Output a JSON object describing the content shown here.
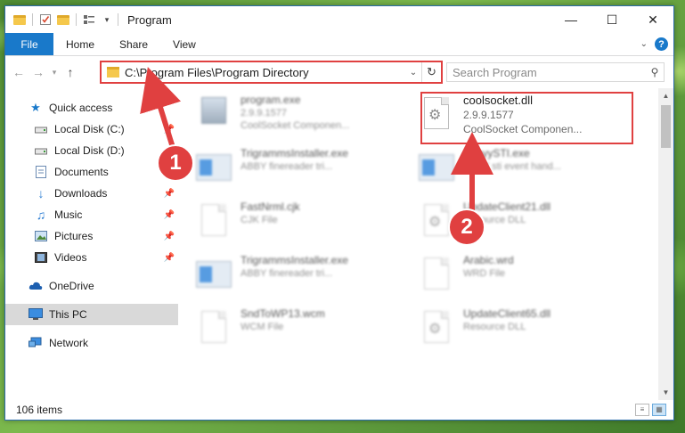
{
  "window": {
    "title": "Program",
    "controls": {
      "minimize": "—",
      "maximize": "☐",
      "close": "✕"
    }
  },
  "ribbon": {
    "tabs": [
      "File",
      "Home",
      "Share",
      "View"
    ],
    "expand_icon": "chevron-down-icon",
    "help_label": "?"
  },
  "address": {
    "path": "C:\\Program Files\\Program Directory",
    "search_placeholder": "Search Program"
  },
  "sidebar": {
    "items": [
      {
        "label": "Quick access",
        "icon": "star-icon",
        "pinned": false
      },
      {
        "label": "Local Disk (C:)",
        "icon": "drive-icon",
        "pinned": true
      },
      {
        "label": "Local Disk (D:)",
        "icon": "drive-icon",
        "pinned": false
      },
      {
        "label": "Documents",
        "icon": "documents-icon",
        "pinned": true
      },
      {
        "label": "Downloads",
        "icon": "download-icon",
        "pinned": true
      },
      {
        "label": "Music",
        "icon": "music-icon",
        "pinned": true
      },
      {
        "label": "Pictures",
        "icon": "pictures-icon",
        "pinned": true
      },
      {
        "label": "Videos",
        "icon": "videos-icon",
        "pinned": true
      },
      {
        "label": "OneDrive",
        "icon": "cloud-icon",
        "pinned": false
      },
      {
        "label": "This PC",
        "icon": "computer-icon",
        "pinned": false,
        "selected": true
      },
      {
        "label": "Network",
        "icon": "network-icon",
        "pinned": false
      }
    ]
  },
  "files": [
    {
      "name": "program.exe",
      "line2": "2.9.9.1577",
      "line3": "CoolSocket Componen...",
      "icon": "exe-icon",
      "blurred": true
    },
    {
      "name": "coolsocket.dll",
      "line2": "2.9.9.1577",
      "line3": "CoolSocket Componen...",
      "icon": "dll-gear-icon",
      "blurred": false,
      "highlighted": true
    },
    {
      "name": "TrigrammsInstaller.exe",
      "line2": "ABBY finereader tri...",
      "line3": "",
      "icon": "window-icon",
      "blurred": true
    },
    {
      "name": "AbbyySTI.exe",
      "line2": "ABBY sti event hand...",
      "line3": "",
      "icon": "window-icon",
      "blurred": true
    },
    {
      "name": "FastNrml.cjk",
      "line2": "CJK File",
      "line3": "",
      "icon": "file-icon",
      "blurred": true
    },
    {
      "name": "UpdateClient21.dll",
      "line2": "Resource DLL",
      "line3": "",
      "icon": "dll-gear-icon",
      "blurred": true
    },
    {
      "name": "TrigrammsInstaller.exe",
      "line2": "ABBY finereader tri...",
      "line3": "",
      "icon": "window-icon",
      "blurred": true
    },
    {
      "name": "Arabic.wrd",
      "line2": "WRD File",
      "line3": "",
      "icon": "file-icon",
      "blurred": true
    },
    {
      "name": "SndToWP13.wcm",
      "line2": "WCM File",
      "line3": "",
      "icon": "file-icon",
      "blurred": true
    },
    {
      "name": "UpdateClient65.dll",
      "line2": "Resource DLL",
      "line3": "",
      "icon": "dll-gear-icon",
      "blurred": true
    }
  ],
  "status": {
    "item_count": "106 items"
  },
  "annotations": {
    "step1": "1",
    "step2": "2",
    "color": "#e04040"
  },
  "colors": {
    "accent": "#1979ca",
    "highlight": "#e04040"
  }
}
